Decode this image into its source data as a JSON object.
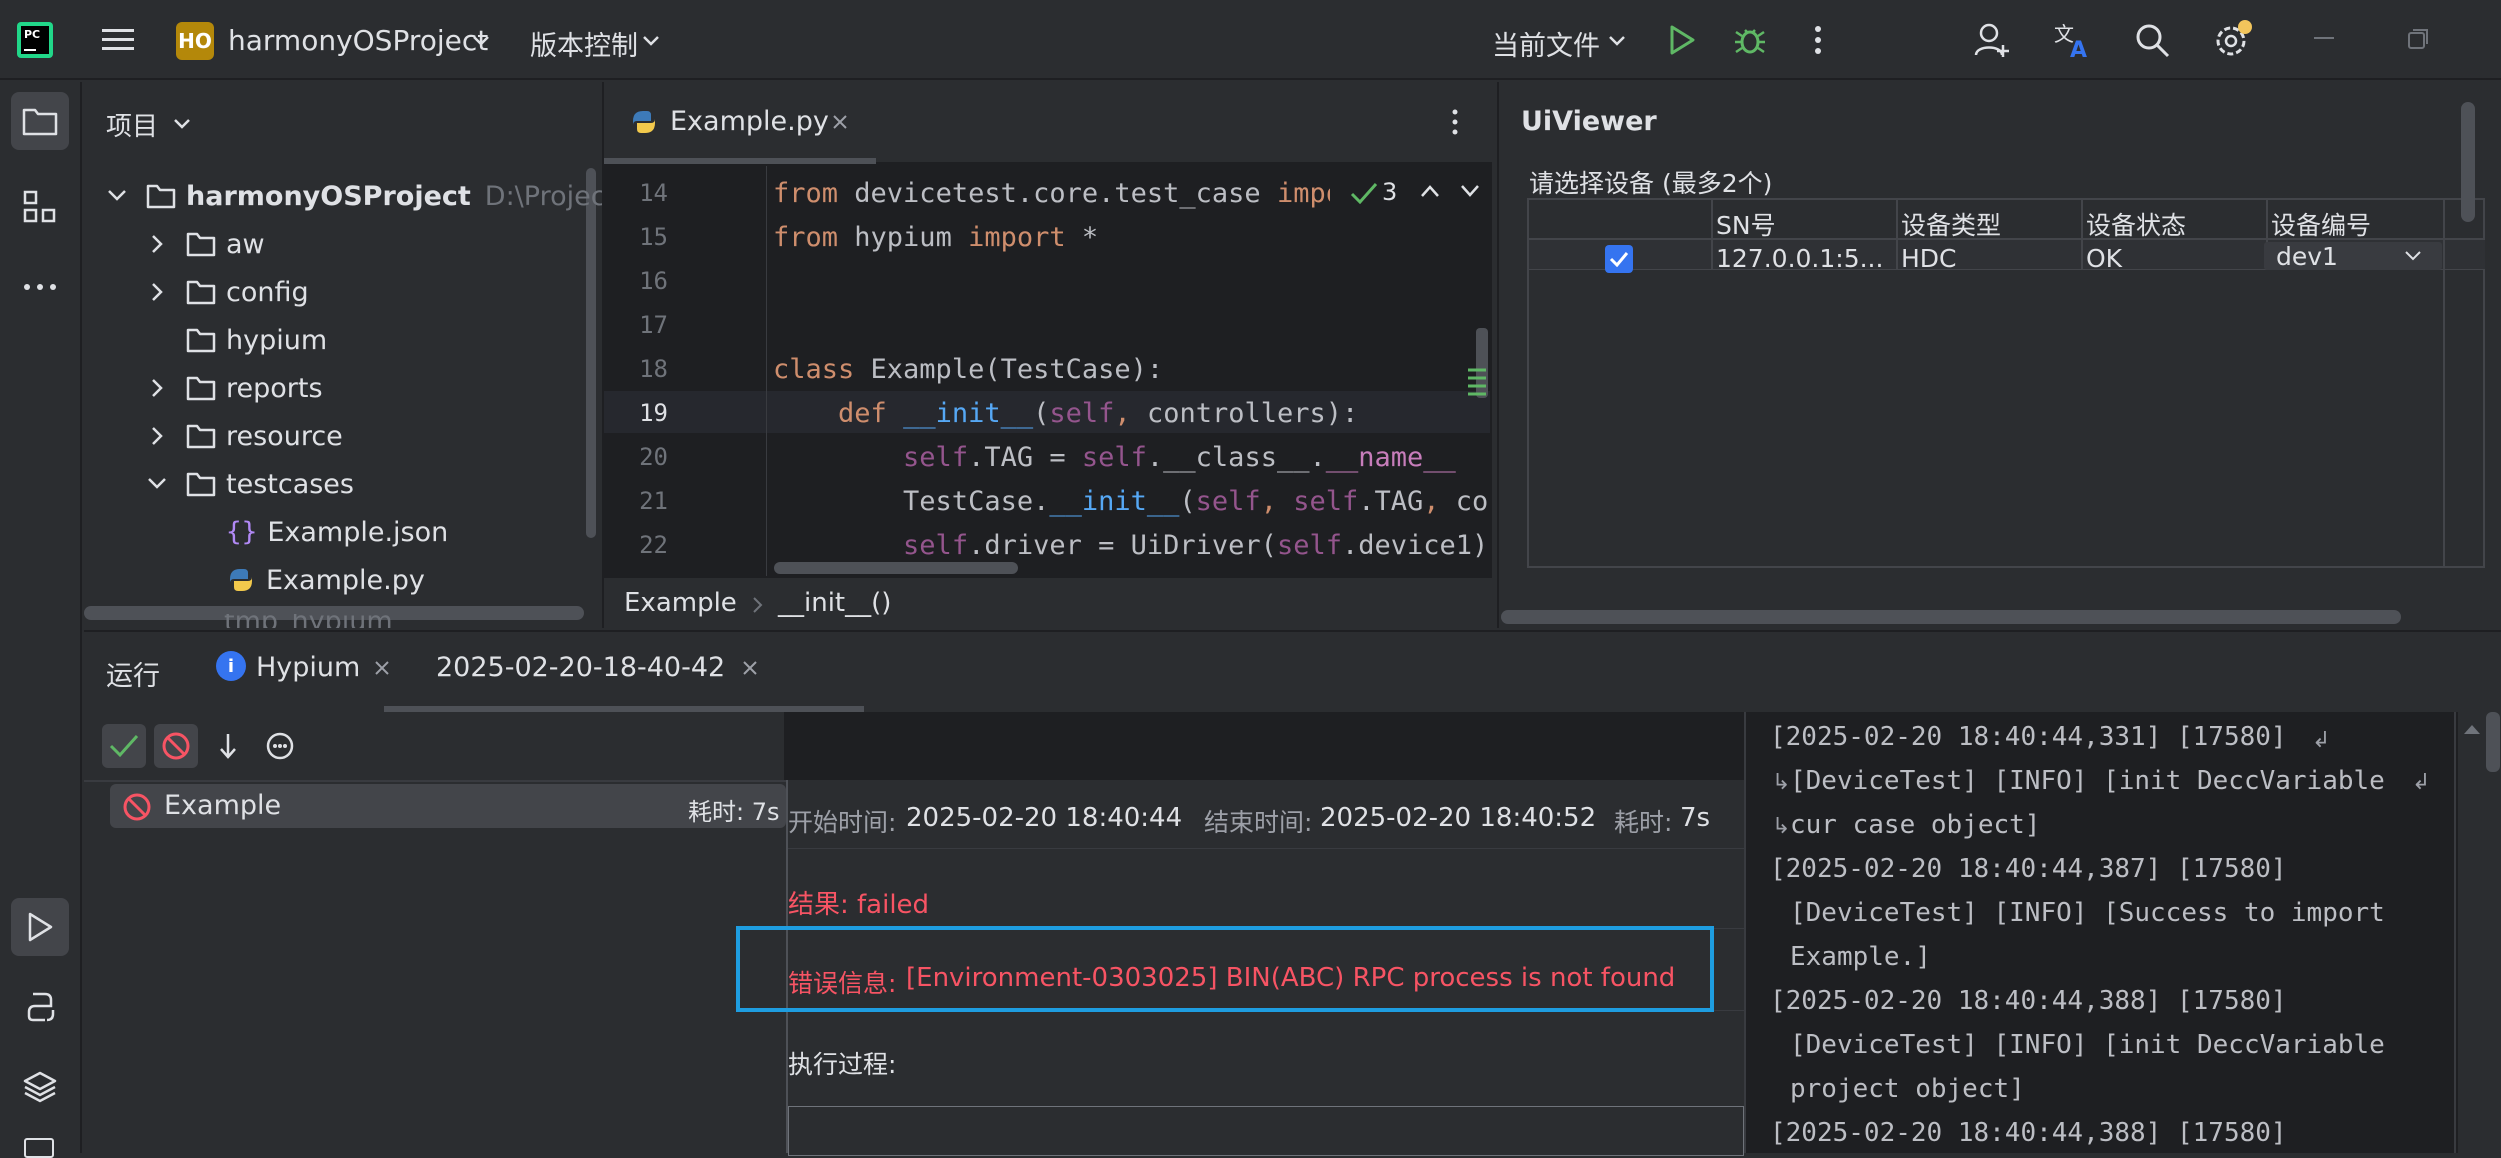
{
  "titlebar": {
    "project_badge": "HO",
    "project_name": "harmonyOSProject",
    "vcs": "版本控制",
    "run_config": "当前文件"
  },
  "project_panel": {
    "title": "项目",
    "root_name": "harmonyOSProject",
    "root_path": "D:\\Projects\\F",
    "items": [
      "aw",
      "config",
      "hypium",
      "reports",
      "resource",
      "testcases",
      "Example.json",
      "Example.py",
      "tmp_hypium"
    ]
  },
  "editor": {
    "tab": "Example.py",
    "inspection_count": "3",
    "line_numbers": [
      "14",
      "15",
      "16",
      "17",
      "18",
      "19",
      "20",
      "21",
      "22"
    ],
    "breadcrumb": [
      "Example",
      "__init__()"
    ]
  },
  "uiviewer": {
    "title": "UiViewer",
    "device_prompt": "请选择设备 (最多2个)",
    "columns": [
      "SN号",
      "设备类型",
      "设备状态",
      "设备编号"
    ],
    "row": {
      "sn": "127.0.0.1:5...",
      "type": "HDC",
      "status": "OK",
      "id": "dev1"
    }
  },
  "run_panel": {
    "title": "运行",
    "tabs": [
      "Hypium",
      "2025-02-20-18-40-42"
    ],
    "test_name": "Example",
    "test_duration": "耗时: 7s",
    "start_label": "开始时间:",
    "start_time": "2025-02-20 18:40:44",
    "end_label": "结束时间:",
    "end_time": "2025-02-20 18:40:52",
    "duration_label": "耗时:",
    "duration": "7s",
    "result": "结果: failed",
    "error_label": "错误信息:",
    "error_msg": "[Environment-0303025] BIN(ABC) RPC process is not found",
    "process_label": "执行过程:"
  },
  "log_lines": [
    "[2025-02-20 18:40:44,331] [17580]",
    "[DeviceTest] [INFO] [init DeccVariable",
    "cur case object]",
    "[2025-02-20 18:40:44,387] [17580]",
    "[DeviceTest] [INFO] [Success to import",
    "Example.]",
    "[2025-02-20 18:40:44,388] [17580]",
    "[DeviceTest] [INFO] [init DeccVariable",
    "project object]",
    "[2025-02-20 18:40:44,388] [17580]"
  ],
  "colors": {
    "accent": "#3574f0",
    "error": "#f75464",
    "highlight_box": "#1e9de0",
    "run_green": "#5fb865"
  }
}
